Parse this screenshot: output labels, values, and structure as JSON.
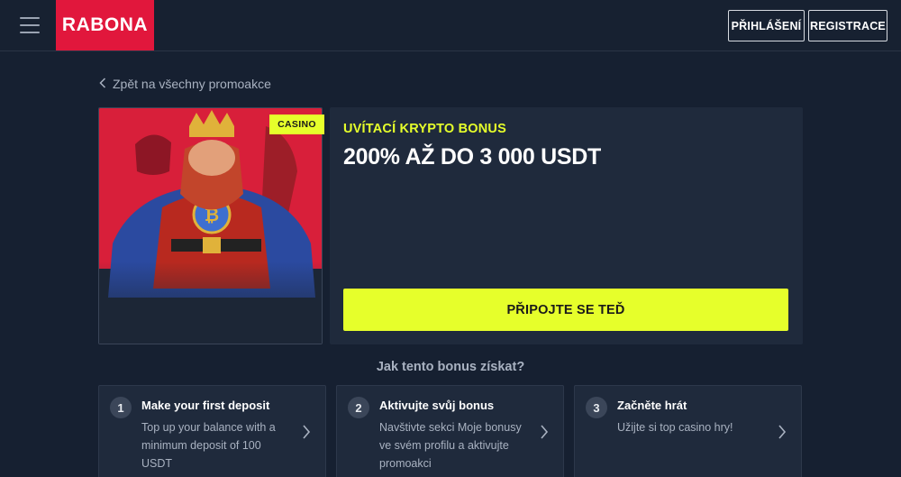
{
  "header": {
    "logo_text": "RABONA",
    "login_label": "PŘIHLÁŠENÍ",
    "register_label": "REGISTRACE"
  },
  "back_link": {
    "label": "Zpět na všechny promoakce"
  },
  "promo": {
    "tag": "CASINO",
    "kicker": "UVÍTACÍ KRYPTO BONUS",
    "title": "200% AŽ DO 3 000 USDT",
    "cta_label": "PŘIPOJTE SE TEĎ"
  },
  "how": {
    "title": "Jak tento bonus získat?",
    "steps": [
      {
        "num": "1",
        "title": "Make your first deposit",
        "desc": "Top up your balance with a minimum deposit of 100 USDT"
      },
      {
        "num": "2",
        "title": "Aktivujte svůj bonus",
        "desc": "Navštivte sekci Moje bonusy ve svém profilu a aktivujte promoakci"
      },
      {
        "num": "3",
        "title": "Začněte hrát",
        "desc": "Užijte si top casino hry!"
      }
    ]
  },
  "colors": {
    "background": "#162031",
    "panel": "#1f2a3c",
    "brand_red": "#e1173c",
    "accent_yellow": "#e6ff2b"
  },
  "icons": [
    "menu-icon",
    "chevron-left-icon",
    "chevron-right-icon"
  ]
}
